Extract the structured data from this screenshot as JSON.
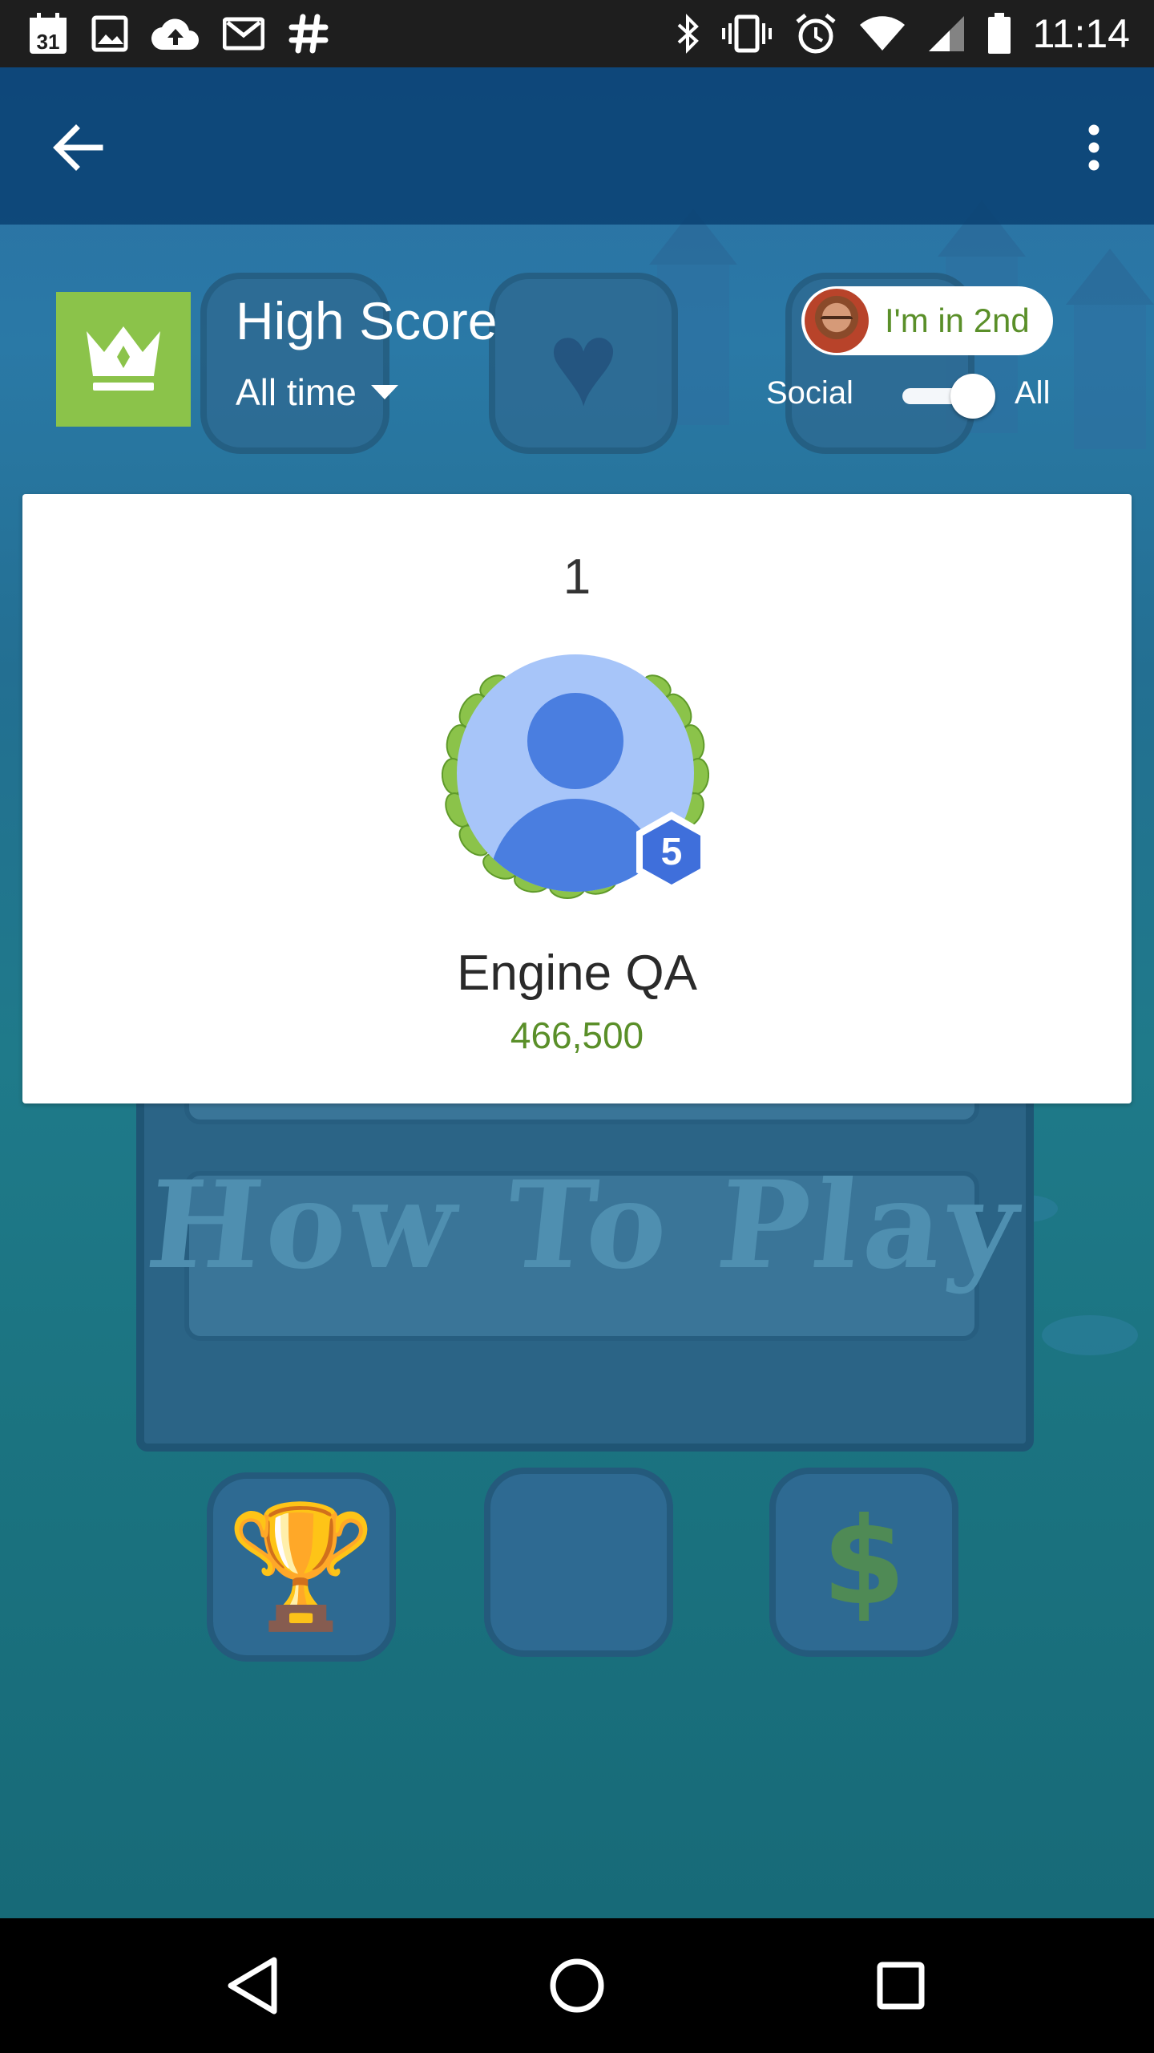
{
  "status_bar": {
    "calendar_day": "31",
    "time": "11:14",
    "left_icons": [
      "calendar-icon",
      "image-icon",
      "cloud-upload-icon",
      "gmail-icon",
      "slack-icon"
    ],
    "right_icons": [
      "bluetooth-icon",
      "vibrate-icon",
      "alarm-icon",
      "wifi-icon",
      "signal-icon",
      "battery-icon"
    ]
  },
  "app_bar": {
    "back_icon": "arrow-back-icon",
    "menu_icon": "more-vert-icon"
  },
  "leaderboard": {
    "icon": "crown-icon",
    "icon_color": "#8bc34a",
    "title": "High Score",
    "timespan": "All time",
    "rank_chip": "I'm in 2nd",
    "filter": {
      "left_label": "Social",
      "right_label": "All",
      "selected": "All"
    }
  },
  "top_player": {
    "rank": "1",
    "name": "Engine QA",
    "score": "466,500",
    "level": "5",
    "score_color": "#5a8f29",
    "level_badge_color": "#3f6fdb"
  },
  "nav_bar": {
    "buttons": [
      "back-triangle-icon",
      "home-circle-icon",
      "recents-square-icon"
    ]
  }
}
